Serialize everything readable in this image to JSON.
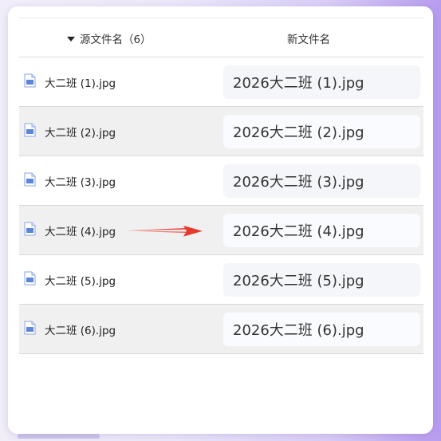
{
  "table": {
    "source_header": "源文件名（6）",
    "new_header": "新文件名",
    "rows": [
      {
        "source": "大二班 (1).jpg",
        "new_name": "2026大二班 (1).jpg"
      },
      {
        "source": "大二班 (2).jpg",
        "new_name": "2026大二班 (2).jpg"
      },
      {
        "source": "大二班 (3).jpg",
        "new_name": "2026大二班 (3).jpg"
      },
      {
        "source": "大二班 (4).jpg",
        "new_name": "2026大二班 (4).jpg"
      },
      {
        "source": "大二班 (5).jpg",
        "new_name": "2026大二班 (5).jpg"
      },
      {
        "source": "大二班 (6).jpg",
        "new_name": "2026大二班 (6).jpg"
      }
    ]
  },
  "icons": {
    "sort": "caret-down-icon",
    "file": "image-file-icon",
    "annotation": "red-arrow-icon"
  },
  "colors": {
    "arrow": "#e8392e",
    "file_icon": "#6b8fd6",
    "alt_row": "#f0f0f0"
  }
}
